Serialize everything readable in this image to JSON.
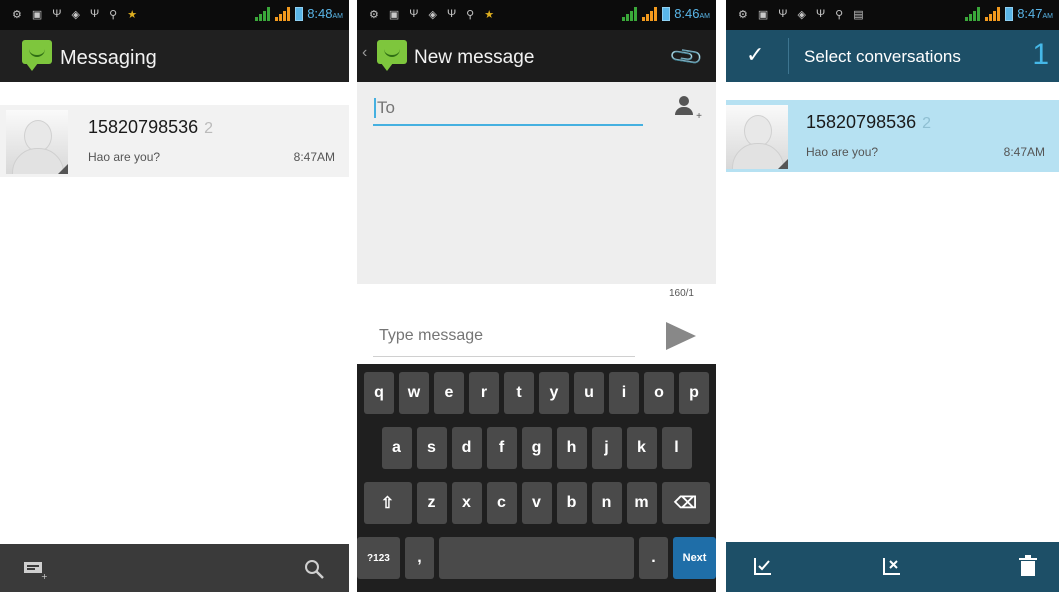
{
  "status": {
    "screen1_time": "8:48",
    "screen2_time": "8:46",
    "screen3_time": "8:47",
    "ampm": "AM"
  },
  "screen1": {
    "title": "Messaging",
    "conversation": {
      "number": "15820798536",
      "count": "2",
      "snippet": "Hao are you?",
      "time": "8:47AM"
    },
    "bottom_icons": [
      "compose-icon",
      "search-icon"
    ]
  },
  "screen2": {
    "title": "New message",
    "to_placeholder": "To",
    "char_counter": "160/1",
    "message_placeholder": "Type message",
    "keyboard": {
      "row1": [
        "q",
        "w",
        "e",
        "r",
        "t",
        "y",
        "u",
        "i",
        "o",
        "p"
      ],
      "row2": [
        "a",
        "s",
        "d",
        "f",
        "g",
        "h",
        "j",
        "k",
        "l"
      ],
      "row3": [
        "z",
        "x",
        "c",
        "v",
        "b",
        "n",
        "m"
      ],
      "sym_key": "?123",
      "comma": ",",
      "period": ".",
      "next": "Next"
    }
  },
  "screen3": {
    "title": "Select conversations",
    "selected_count": "1",
    "conversation": {
      "number": "15820798536",
      "count": "2",
      "snippet": "Hao are you?",
      "time": "8:47AM"
    },
    "bottom_icons": [
      "select-all-icon",
      "deselect-all-icon",
      "trash-icon"
    ]
  },
  "colors": {
    "accent_blue": "#45b0e0",
    "selection_blue": "#b6e1f2",
    "action_bar_blue": "#1d4f67",
    "messaging_green": "#7ec63d"
  }
}
